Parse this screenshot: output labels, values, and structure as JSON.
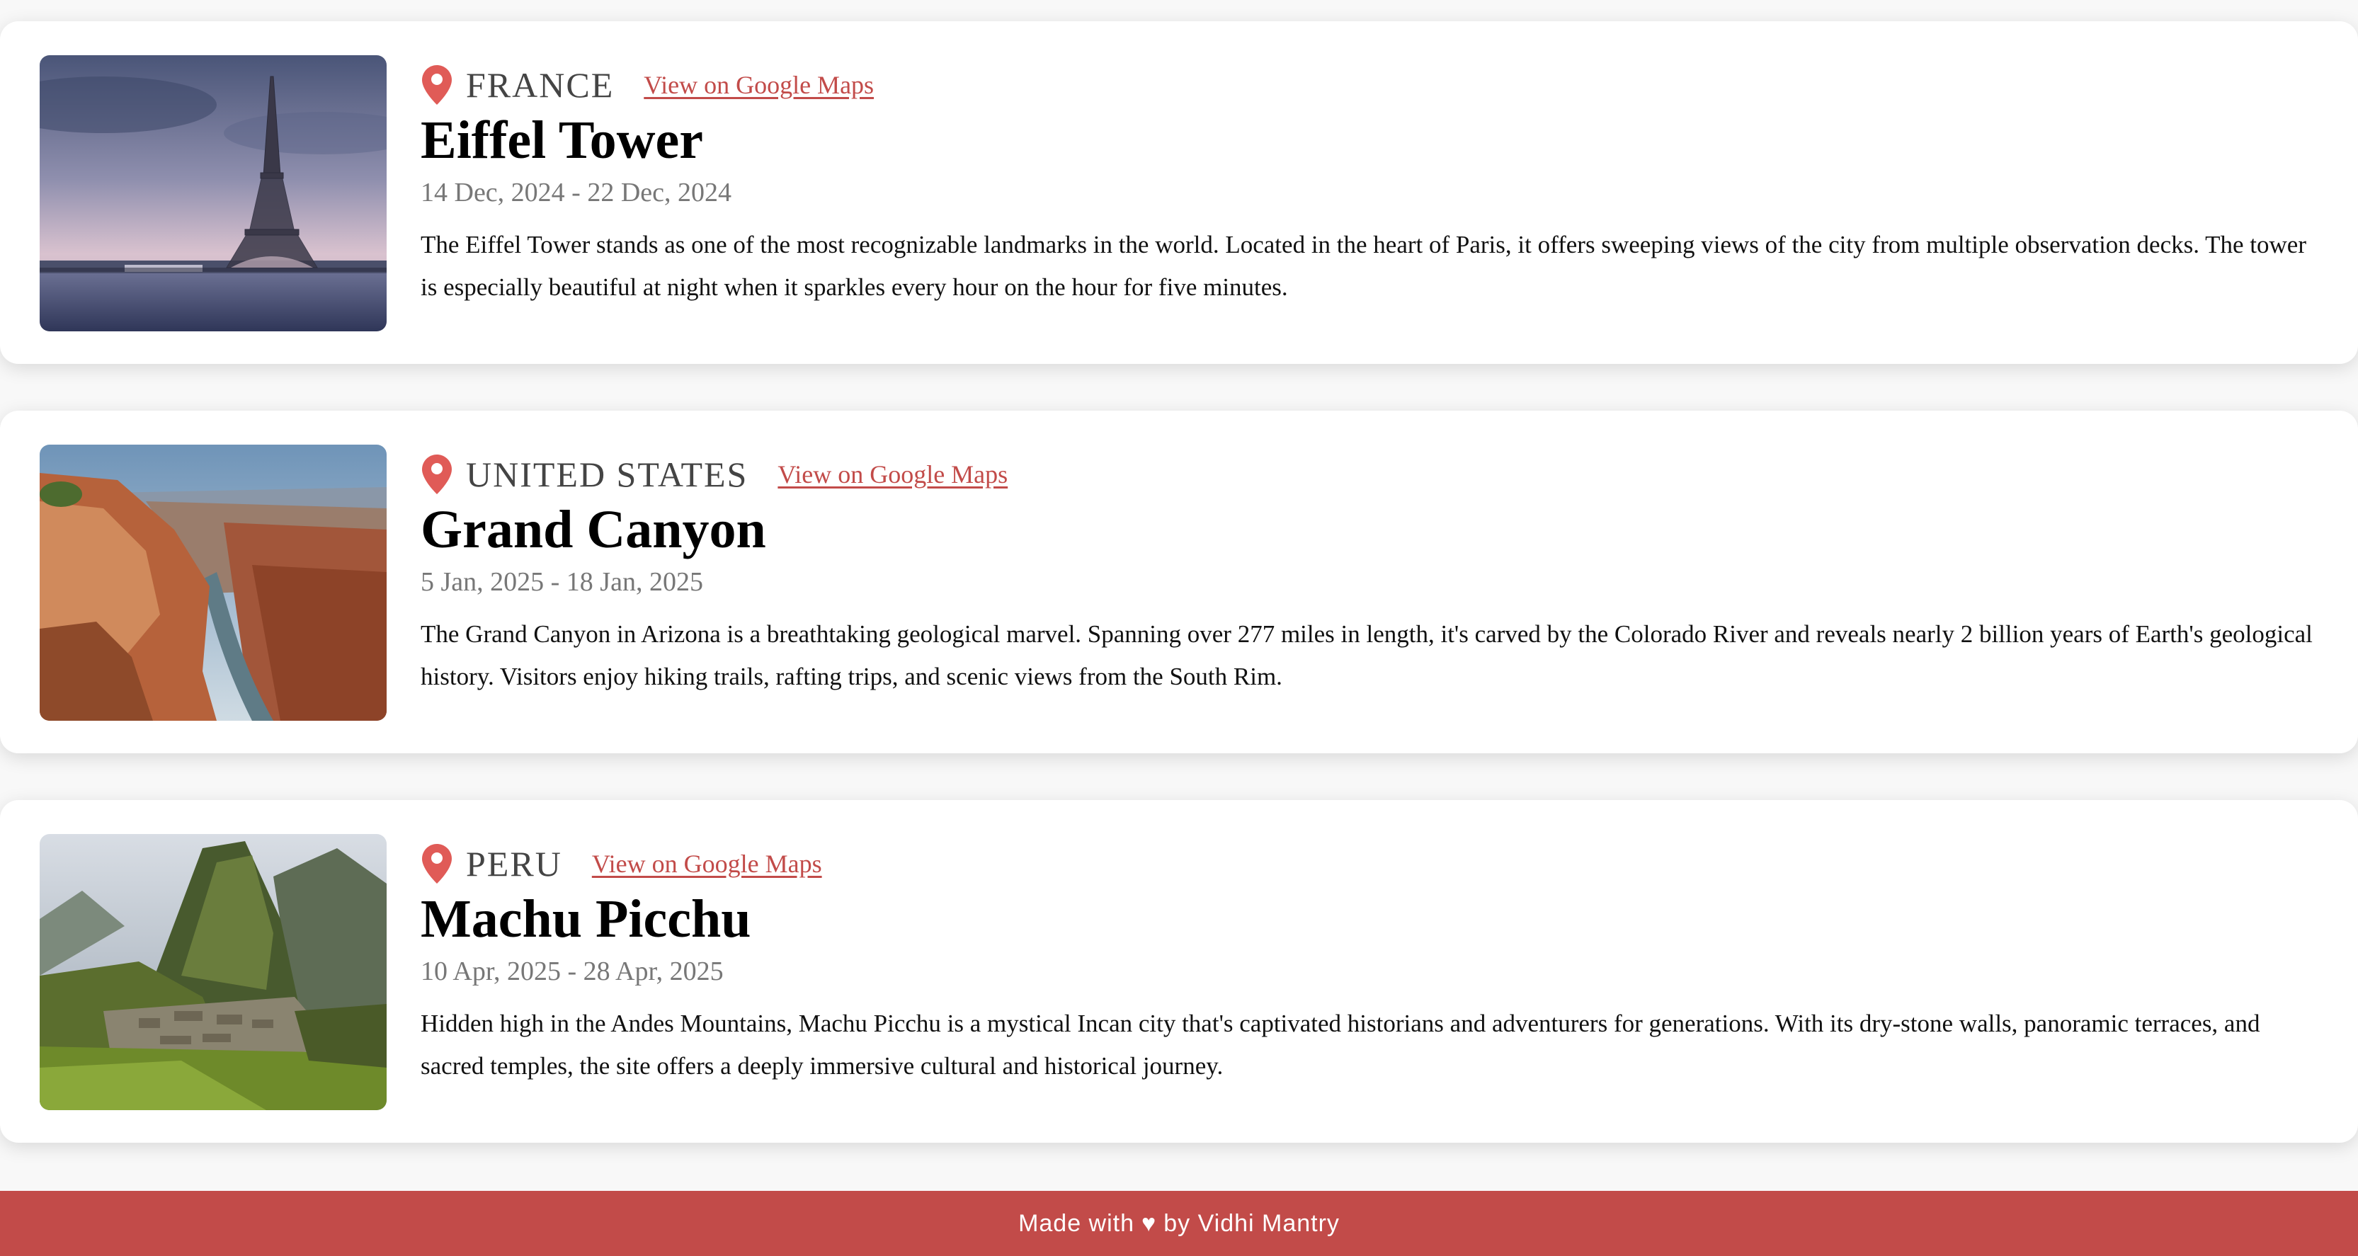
{
  "colors": {
    "accent": "#c24b49",
    "pin": "#e05b57"
  },
  "destinations": [
    {
      "country": "FRANCE",
      "map_link": "View on Google Maps",
      "title": "Eiffel Tower",
      "dates": "14 Dec, 2024 - 22 Dec, 2024",
      "description": "The Eiffel Tower stands as one of the most recognizable landmarks in the world. Located in the heart of Paris, it offers sweeping views of the city from multiple observation decks. The tower is especially beautiful at night when it sparkles every hour on the hour for five minutes."
    },
    {
      "country": "UNITED STATES",
      "map_link": "View on Google Maps",
      "title": "Grand Canyon",
      "dates": "5 Jan, 2025 - 18 Jan, 2025",
      "description": "The Grand Canyon in Arizona is a breathtaking geological marvel. Spanning over 277 miles in length, it's carved by the Colorado River and reveals nearly 2 billion years of Earth's geological history. Visitors enjoy hiking trails, rafting trips, and scenic views from the South Rim."
    },
    {
      "country": "PERU",
      "map_link": "View on Google Maps",
      "title": "Machu Picchu",
      "dates": "10 Apr, 2025 - 28 Apr, 2025",
      "description": "Hidden high in the Andes Mountains, Machu Picchu is a mystical Incan city that's captivated historians and adventurers for generations. With its dry-stone walls, panoramic terraces, and sacred temples, the site offers a deeply immersive cultural and historical journey."
    }
  ],
  "footer": {
    "prefix": "Made with",
    "heart": "♥",
    "suffix": "by Vidhi Mantry"
  }
}
